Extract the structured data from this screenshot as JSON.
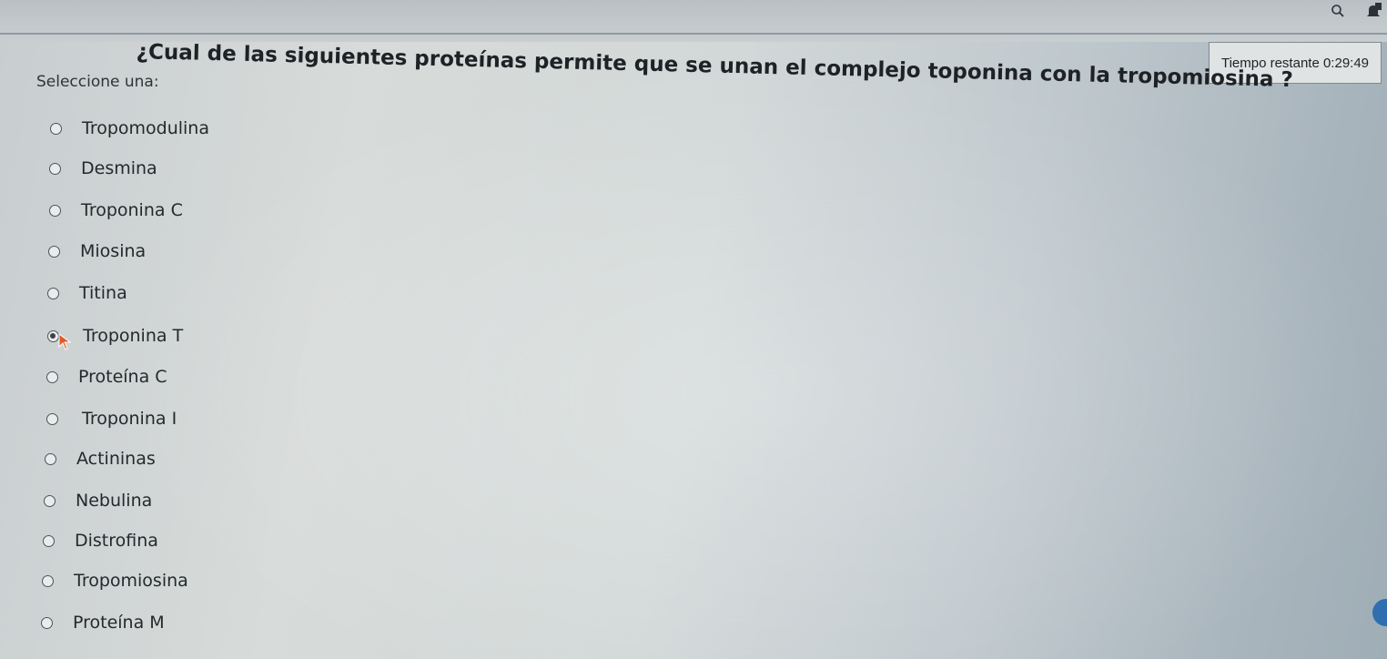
{
  "question": "¿Cual de las siguientes proteínas permite que se unan el complejo toponina con la tropomiosina ?",
  "prompt": "Seleccione una:",
  "timer": {
    "label": "Tiempo restante",
    "value": "0:29:49"
  },
  "options": [
    {
      "label": "Tropomodulina",
      "selected": false
    },
    {
      "label": "Desmina",
      "selected": false
    },
    {
      "label": "Troponina C",
      "selected": false
    },
    {
      "label": "Miosina",
      "selected": false
    },
    {
      "label": "Titina",
      "selected": false
    },
    {
      "label": "Troponina T",
      "selected": true
    },
    {
      "label": "Proteína C",
      "selected": false
    },
    {
      "label": "Troponina I",
      "selected": false
    },
    {
      "label": "Actininas",
      "selected": false
    },
    {
      "label": "Nebulina",
      "selected": false
    },
    {
      "label": "Distrofina",
      "selected": false
    },
    {
      "label": "Tropomiosina",
      "selected": false
    },
    {
      "label": "Proteína M",
      "selected": false
    }
  ],
  "icons": {
    "search": "search-icon",
    "notifications": "bell-icon",
    "help": "help-bubble-icon"
  },
  "colors": {
    "accent": "#2f6fb0"
  }
}
